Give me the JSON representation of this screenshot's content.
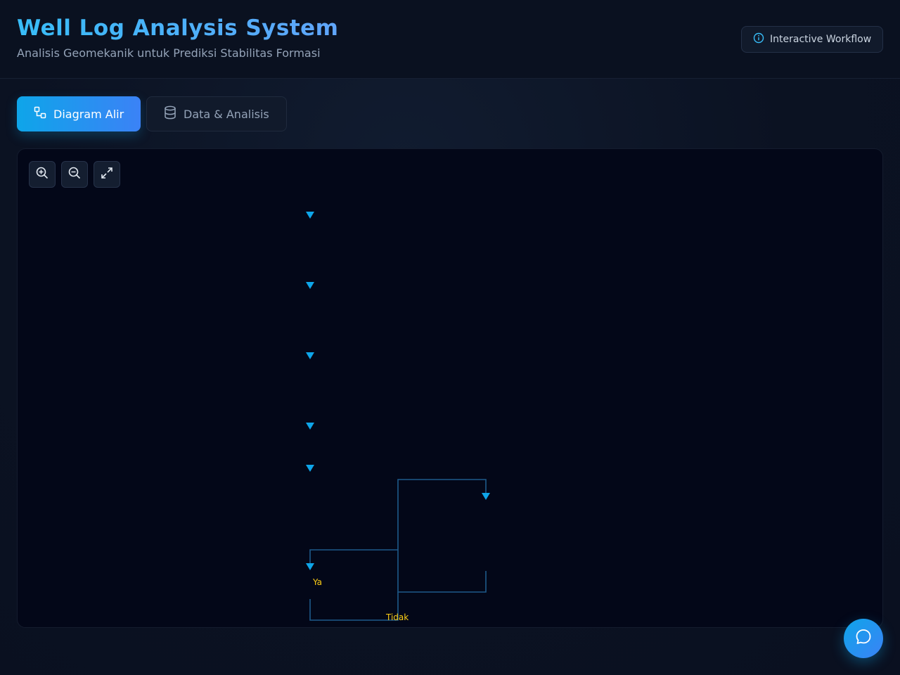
{
  "header": {
    "title": "Well Log Analysis System",
    "subtitle": "Analisis Geomekanik untuk Prediksi Stabilitas Formasi",
    "workflow_badge": "Interactive Workflow"
  },
  "tabs": [
    {
      "label": "Diagram Alir",
      "icon": "flowchart-icon",
      "active": true
    },
    {
      "label": "Data & Analisis",
      "icon": "database-icon",
      "active": false
    }
  ],
  "toolbar": {
    "zoom_in_icon": "zoom-in-icon",
    "zoom_out_icon": "zoom-out-icon",
    "fit_icon": "expand-icon"
  },
  "flowchart": {
    "yes_label": "Ya",
    "no_label": "Tidak"
  },
  "colors": {
    "accent": "#0ea5e9",
    "accent_blue": "#3b82f6",
    "connector": "#1e5a8a",
    "arrow": "#0ea5e9",
    "decision_label": "#facc15"
  },
  "chat_button_icon": "chat-icon"
}
